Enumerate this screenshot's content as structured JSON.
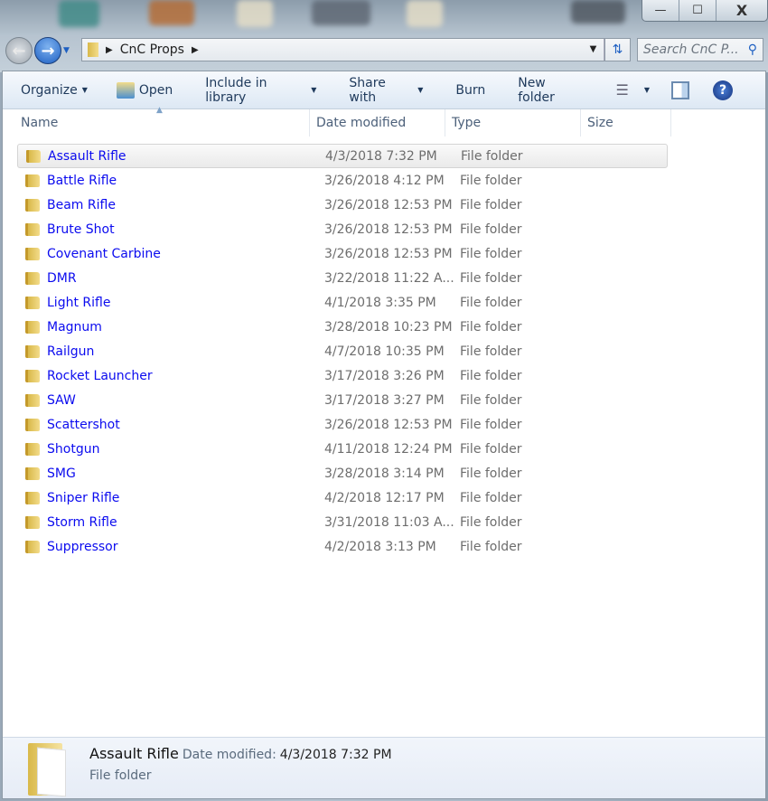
{
  "window": {
    "minimize": "—",
    "maximize": "☐",
    "close": "X"
  },
  "address": {
    "crumb": "CnC Props",
    "search_placeholder": "Search CnC P..."
  },
  "toolbar": {
    "organize": "Organize",
    "open": "Open",
    "include": "Include in library",
    "share": "Share with",
    "burn": "Burn",
    "new_folder": "New folder"
  },
  "columns": {
    "name": "Name",
    "date": "Date modified",
    "type": "Type",
    "size": "Size"
  },
  "files": [
    {
      "name": "Assault Rifle",
      "date": "4/3/2018 7:32 PM",
      "type": "File folder",
      "selected": true
    },
    {
      "name": "Battle Rifle",
      "date": "3/26/2018 4:12 PM",
      "type": "File folder"
    },
    {
      "name": "Beam Rifle",
      "date": "3/26/2018 12:53 PM",
      "type": "File folder"
    },
    {
      "name": "Brute Shot",
      "date": "3/26/2018 12:53 PM",
      "type": "File folder"
    },
    {
      "name": "Covenant Carbine",
      "date": "3/26/2018 12:53 PM",
      "type": "File folder"
    },
    {
      "name": "DMR",
      "date": "3/22/2018 11:22 A...",
      "type": "File folder"
    },
    {
      "name": "Light Rifle",
      "date": "4/1/2018 3:35 PM",
      "type": "File folder"
    },
    {
      "name": "Magnum",
      "date": "3/28/2018 10:23 PM",
      "type": "File folder"
    },
    {
      "name": "Railgun",
      "date": "4/7/2018 10:35 PM",
      "type": "File folder"
    },
    {
      "name": "Rocket Launcher",
      "date": "3/17/2018 3:26 PM",
      "type": "File folder"
    },
    {
      "name": "SAW",
      "date": "3/17/2018 3:27 PM",
      "type": "File folder"
    },
    {
      "name": "Scattershot",
      "date": "3/26/2018 12:53 PM",
      "type": "File folder"
    },
    {
      "name": "Shotgun",
      "date": "4/11/2018 12:24 PM",
      "type": "File folder"
    },
    {
      "name": "SMG",
      "date": "3/28/2018 3:14 PM",
      "type": "File folder"
    },
    {
      "name": "Sniper Rifle",
      "date": "4/2/2018 12:17 PM",
      "type": "File folder"
    },
    {
      "name": "Storm Rifle",
      "date": "3/31/2018 11:03 A...",
      "type": "File folder"
    },
    {
      "name": "Suppressor",
      "date": "4/2/2018 3:13 PM",
      "type": "File folder"
    }
  ],
  "details": {
    "name": "Assault Rifle",
    "date_label": "Date modified:",
    "date": "4/3/2018 7:32 PM",
    "type": "File folder"
  }
}
